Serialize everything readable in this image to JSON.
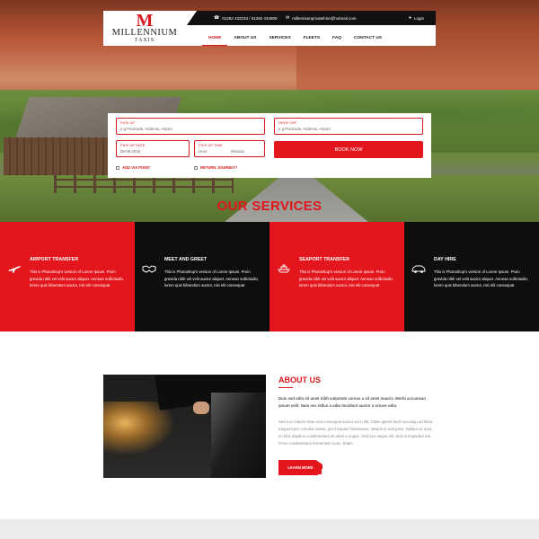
{
  "logo": {
    "mark": "M",
    "name": "MILLENNIUM",
    "sub": "TAXIS"
  },
  "topbar": {
    "phone": "01282 433233 / 01282 434600",
    "email": "millenniumprivatehire@hotmail.com",
    "login": "Login"
  },
  "nav": {
    "items": [
      "HOME",
      "ABOUT US",
      "SERVICES",
      "FLEETS",
      "FAQ",
      "CONTACT US"
    ],
    "active": "HOME"
  },
  "booking": {
    "pickup_label": "PICK UP",
    "pickup_placeholder": "e.g Postcode, Address, Airport",
    "dropoff_label": "DROP OFF",
    "dropoff_placeholder": "e.g Postcode, Address, Airport",
    "date_label": "PICK UP DATE",
    "date_value": "09-08-2016",
    "time_label": "PICK UP TIME",
    "time_hour": "Hour",
    "time_minute": "Minutes",
    "book_label": "BOOK NOW",
    "via_label": "ADD VIA POINT",
    "return_label": "RETURN JOURNEY?"
  },
  "services": {
    "heading": "OUR SERVICES",
    "items": [
      {
        "title": "AIRPORT TRANSFER",
        "text": "This is Photoshop's version of Lorem Ipsum. Proin gravida nibh vel velit auctor aliquet. Aenean sollicitudin, lorem quis bibendum auctor, nisi elit consequat",
        "icon": "plane-icon"
      },
      {
        "title": "MEET AND GREET",
        "text": "This is Photoshop's version of Lorem Ipsum. Proin gravida nibh vel velit auctor aliquet. Aenean sollicitudin, lorem quis bibendum auctor, nisi elit consequat",
        "icon": "handshake-icon"
      },
      {
        "title": "SEAPORT TRANSFER",
        "text": "This is Photoshop's version of Lorem Ipsum. Proin gravida nibh vel velit auctor aliquet. Aenean sollicitudin, lorem quis bibendum auctor, nisi elit consequat",
        "icon": "ship-icon"
      },
      {
        "title": "DAY HIRE",
        "text": "This is Photoshop's version of Lorem Ipsum. Proin gravida nibh vel velit auctor aliquet. Aenean sollicitudin, lorem quis bibendum auctor, nisi elit consequat",
        "icon": "car-icon"
      }
    ]
  },
  "about": {
    "title": "ABOUT US",
    "lead": "Duis sed odio sit amet nibh vulputate cursus a sit amet mauris. Morbi accumsan ipsum velit. Nam nec tellus a odio tincidunt auctor a ornare odio.",
    "body": "Sed non mauris vitae erat consequat auctor eu in elit. Class aptent taciti sociosqu ad litora torquent per conubia nostra, per inceptos himenaeos. Mauris in erat justo. Nullam ac urna eu felis dapibus condimentum sit amet a augue. Sed non neque elit. Sed ut imperdiet nisi. Proin condimentum fermentum nunc. Etiam",
    "button": "LEARN MORE"
  },
  "colors": {
    "accent": "#e2161c",
    "dark": "#0e0e0e"
  }
}
